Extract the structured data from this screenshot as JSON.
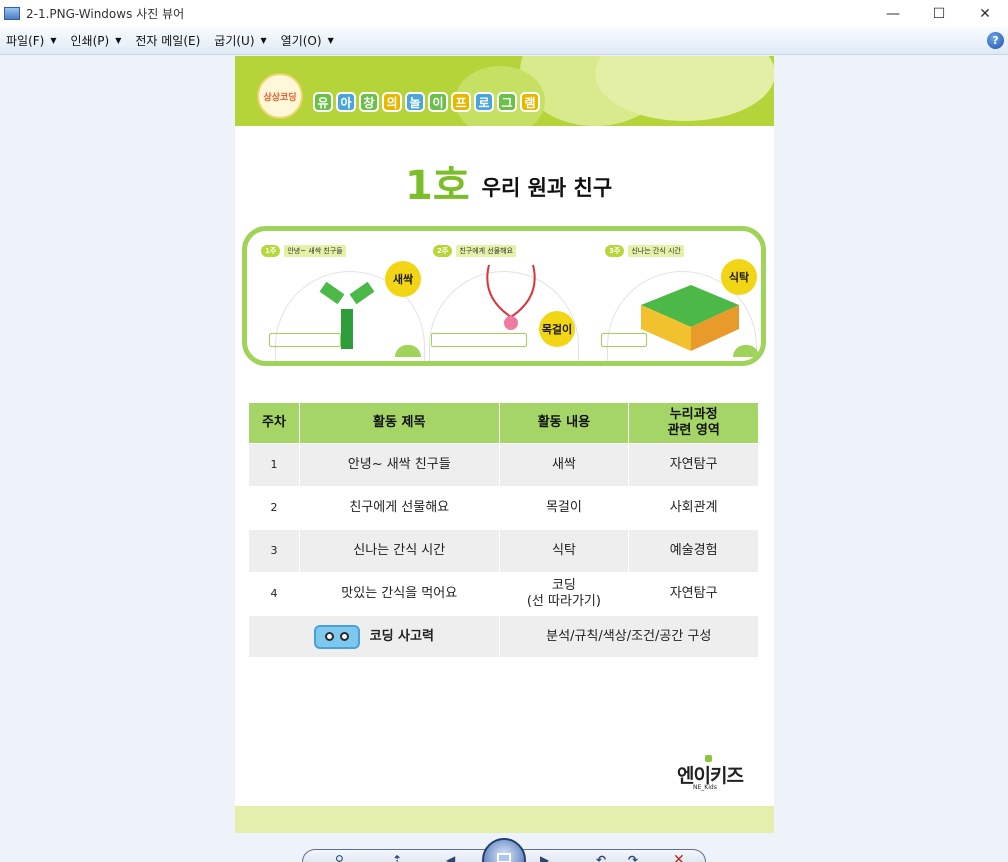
{
  "window": {
    "title": "2-1.PNG-Windows 사진 뷰어",
    "minimize_icon": "minimize-icon",
    "maximize_icon": "maximize-icon",
    "close_icon": "close-icon"
  },
  "menu": {
    "items": [
      {
        "label": "파일(F)",
        "has_arrow": true
      },
      {
        "label": "인쇄(P)",
        "has_arrow": true
      },
      {
        "label": "전자 메일(E)",
        "has_arrow": false
      },
      {
        "label": "굽기(U)",
        "has_arrow": true
      },
      {
        "label": "열기(O)",
        "has_arrow": true
      }
    ],
    "help_label": "?"
  },
  "document": {
    "logo_text": "상상코딩",
    "program_title_chars": [
      "유",
      "아",
      "창",
      "의",
      "놀",
      "이",
      "프",
      "로",
      "그",
      "램"
    ],
    "program_title_colors": [
      "#6cc04a",
      "#4aa5d8",
      "#6cc04a",
      "#e6b800",
      "#4aa5d8",
      "#6cc04a",
      "#e6b800",
      "#4aa5d8",
      "#6cc04a",
      "#e6b800"
    ],
    "episode_number": "1호",
    "episode_title": "우리 원과 친구",
    "weeks": [
      {
        "badge": "1주",
        "name": "안녕~ 새싹 친구들",
        "ribbon": "새싹"
      },
      {
        "badge": "2주",
        "name": "친구에게 선물해요",
        "ribbon": "목걸이"
      },
      {
        "badge": "3주",
        "name": "신나는 간식 시간",
        "ribbon": "식탁"
      }
    ],
    "table": {
      "headers": [
        "주차",
        "활동 제목",
        "활동 내용",
        "누리과정\n관련 영역"
      ],
      "rows": [
        {
          "week": "1",
          "title": "안녕~ 새싹 친구들",
          "content": "새싹",
          "area": "자연탐구"
        },
        {
          "week": "2",
          "title": "친구에게 선물해요",
          "content": "목걸이",
          "area": "사회관계"
        },
        {
          "week": "3",
          "title": "신나는 간식 시간",
          "content": "식탁",
          "area": "예술경험"
        },
        {
          "week": "4",
          "title": "맛있는 간식을 먹어요",
          "content": "코딩\n(선 따라가기)",
          "area": "자연탐구"
        }
      ],
      "coding_label": "코딩 사고력",
      "coding_value": "분석/규칙/색상/조건/공간 구성"
    },
    "brand_main": "엔이키즈",
    "brand_sub": "NE_Kids"
  },
  "toolbar": {
    "icons": [
      "zoom-icon",
      "fit-icon",
      "previous-icon",
      "slideshow-icon",
      "next-icon",
      "rotate-left-icon",
      "rotate-right-icon",
      "delete-icon"
    ]
  },
  "colors": {
    "header_green": "#b4d43a",
    "table_header": "#a6d567",
    "accent_green": "#7cbd2a",
    "ribbon_yellow": "#f2d616"
  }
}
